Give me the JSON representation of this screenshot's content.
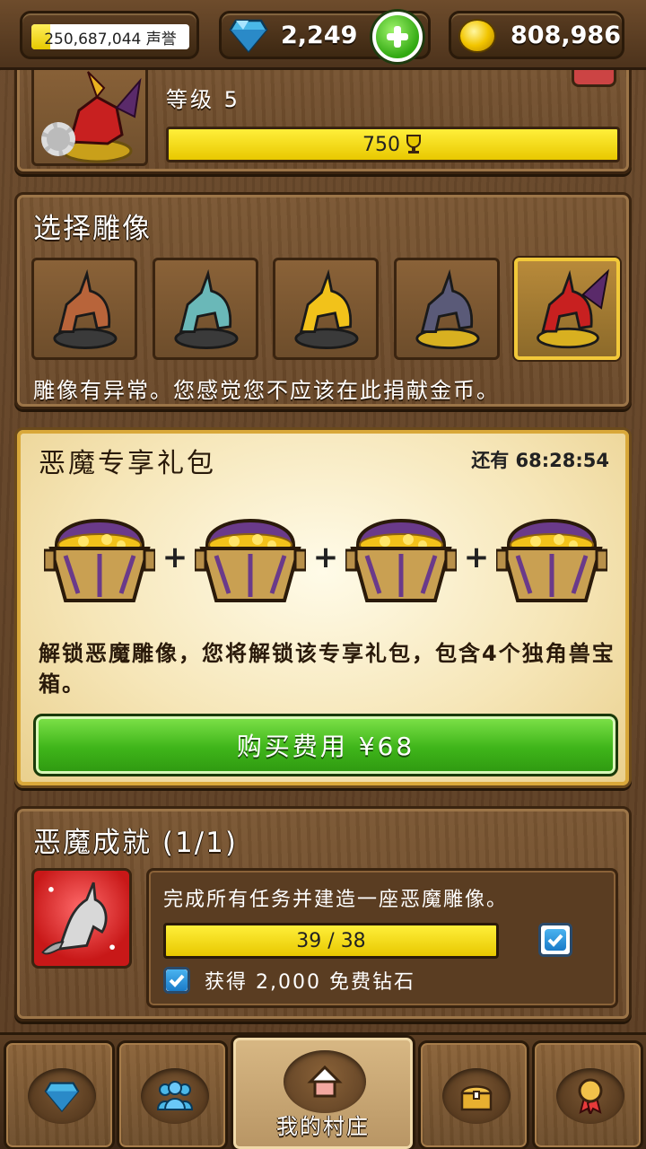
{
  "topbar": {
    "reputation_text": "250,687,044 声誉",
    "reputation_fill": 0.12,
    "gems": "2,249",
    "gold": "808,986"
  },
  "header": {
    "title": "",
    "level": "等级 5",
    "trophy_value": "750"
  },
  "select_statue": {
    "title": "选择雕像",
    "statues": [
      {
        "name": "bronze-unicorn",
        "color": "#b8643a"
      },
      {
        "name": "cyan-unicorn",
        "color": "#6ab8b8"
      },
      {
        "name": "golden-unicorn",
        "color": "#f2c21a"
      },
      {
        "name": "dark-unicorn",
        "color": "#5a5a78"
      },
      {
        "name": "demon-unicorn",
        "color": "#c82020"
      }
    ],
    "selected_index": 4,
    "description": "雕像有异常。您感觉您不应该在此捐献金币。"
  },
  "offer": {
    "title": "恶魔专享礼包",
    "timer": "还有 68:28:54",
    "chest_count": 4,
    "description": "解锁恶魔雕像，您将解锁该专享礼包，包含4个独角兽宝箱。",
    "buy_label": "购买费用 ¥68"
  },
  "achievement": {
    "title": "恶魔成就 (1/1)",
    "description": "完成所有任务并建造一座恶魔雕像。",
    "progress_text": "39 / 38",
    "progress_fraction": 1.0,
    "reward_text": "获得 2,000 免费钻石"
  },
  "nav": {
    "items": [
      {
        "name": "gems",
        "label": ""
      },
      {
        "name": "friends",
        "label": ""
      },
      {
        "name": "village",
        "label": "我的村庄"
      },
      {
        "name": "chest",
        "label": ""
      },
      {
        "name": "achievements",
        "label": ""
      }
    ]
  },
  "colors": {
    "wood": "#6b4a2c",
    "accent_yellow": "#f2d21a",
    "button_green": "#3fb51a",
    "gem_blue": "#4ab8e8"
  }
}
